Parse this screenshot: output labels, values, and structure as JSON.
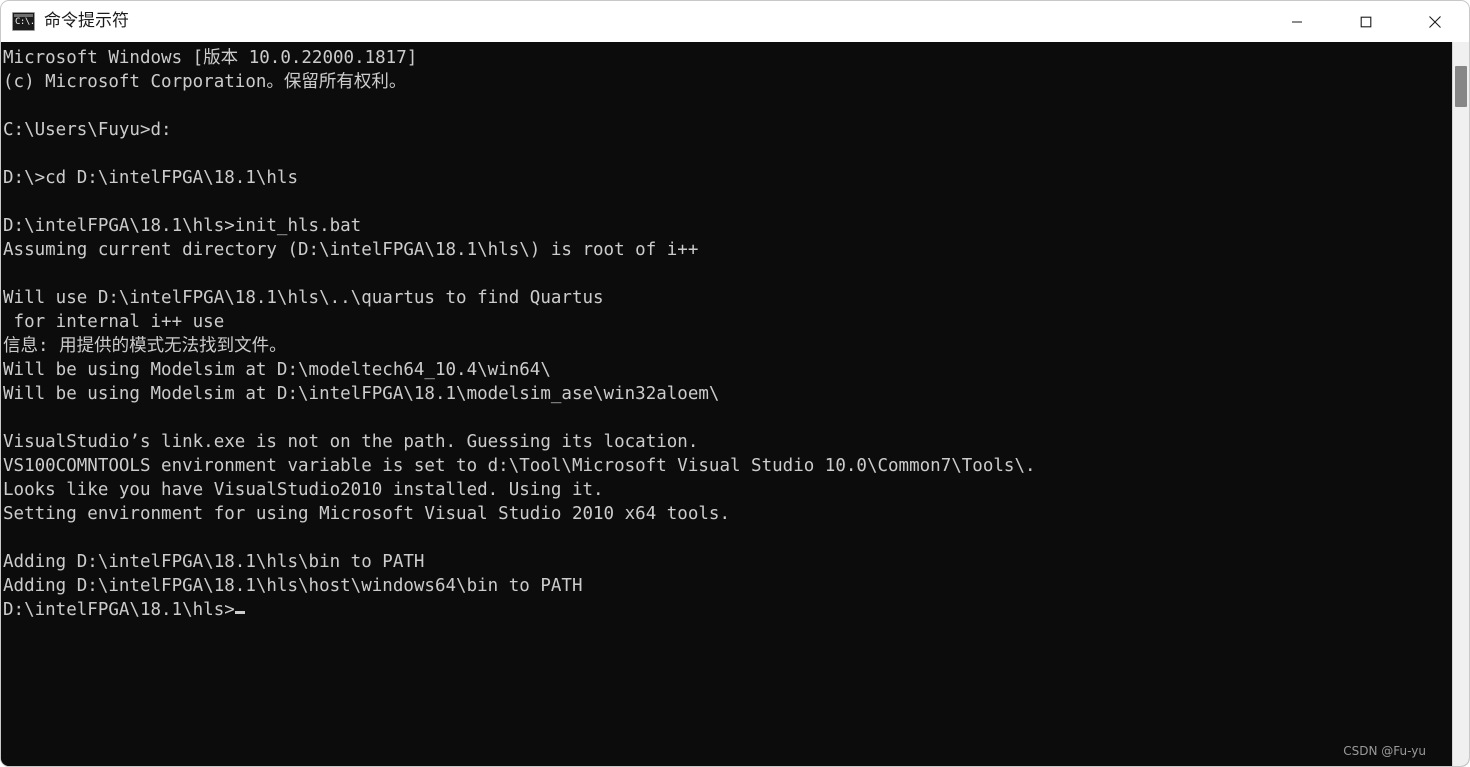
{
  "window": {
    "title": "命令提示符",
    "icon_name": "cmd-icon",
    "icon_glyph": "C:\\.",
    "background_color": "#0c0c0c",
    "text_color": "#cccccc",
    "titlebar_color": "#ffffff"
  },
  "controls": {
    "minimize_label": "最小化",
    "maximize_label": "最大化",
    "close_label": "关闭"
  },
  "console": {
    "lines": [
      "Microsoft Windows [版本 10.0.22000.1817]",
      "(c) Microsoft Corporation。保留所有权利。",
      "",
      "C:\\Users\\Fuyu>d:",
      "",
      "D:\\>cd D:\\intelFPGA\\18.1\\hls",
      "",
      "D:\\intelFPGA\\18.1\\hls>init_hls.bat",
      "Assuming current directory (D:\\intelFPGA\\18.1\\hls\\) is root of i++",
      "",
      "Will use D:\\intelFPGA\\18.1\\hls\\..\\quartus to find Quartus",
      " for internal i++ use",
      "信息: 用提供的模式无法找到文件。",
      "Will be using Modelsim at D:\\modeltech64_10.4\\win64\\",
      "Will be using Modelsim at D:\\intelFPGA\\18.1\\modelsim_ase\\win32aloem\\",
      "",
      "VisualStudio’s link.exe is not on the path. Guessing its location.",
      "VS100COMNTOOLS environment variable is set to d:\\Tool\\Microsoft Visual Studio 10.0\\Common7\\Tools\\.",
      "Looks like you have VisualStudio2010 installed. Using it.",
      "Setting environment for using Microsoft Visual Studio 2010 x64 tools.",
      "",
      "Adding D:\\intelFPGA\\18.1\\hls\\bin to PATH",
      "Adding D:\\intelFPGA\\18.1\\hls\\host\\windows64\\bin to PATH"
    ],
    "prompt": "D:\\intelFPGA\\18.1\\hls>",
    "cursor": "_"
  },
  "scrollbar": {
    "thumb_position": "top"
  },
  "watermark": {
    "text": "CSDN @Fu-yu"
  }
}
